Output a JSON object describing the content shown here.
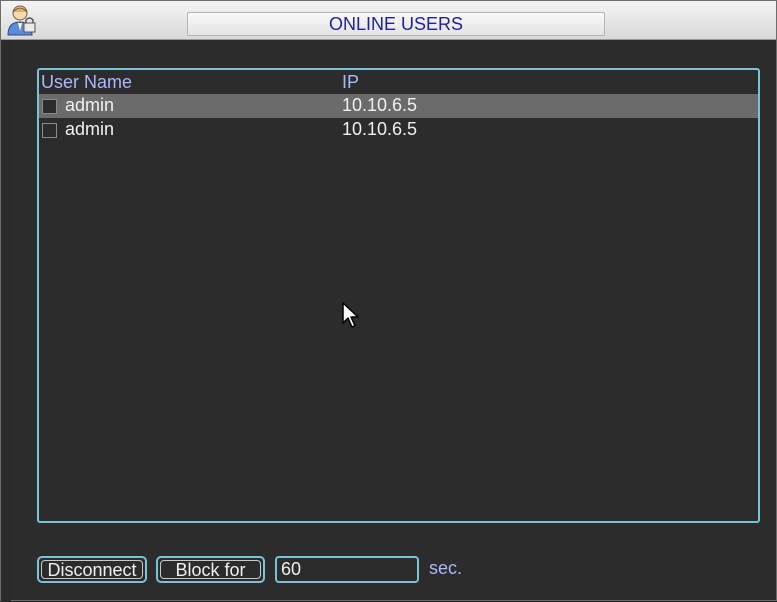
{
  "window": {
    "title": "ONLINE USERS"
  },
  "table": {
    "headers": {
      "user_name": "User Name",
      "ip": "IP"
    },
    "rows": [
      {
        "name": "admin",
        "ip": "10.10.6.5",
        "selected": true
      },
      {
        "name": "admin",
        "ip": "10.10.6.5",
        "selected": false
      }
    ]
  },
  "controls": {
    "disconnect_label": "Disconnect",
    "block_label": "Block for",
    "block_seconds": "60",
    "unit": "sec."
  },
  "icons": {
    "title": "user-lock-icon",
    "cursor": "mouse-pointer-icon"
  },
  "colors": {
    "accent_border": "#78c3d8",
    "title_text": "#2020a0",
    "header_text": "#aab8ff",
    "selected_row": "#6b6b6b"
  }
}
